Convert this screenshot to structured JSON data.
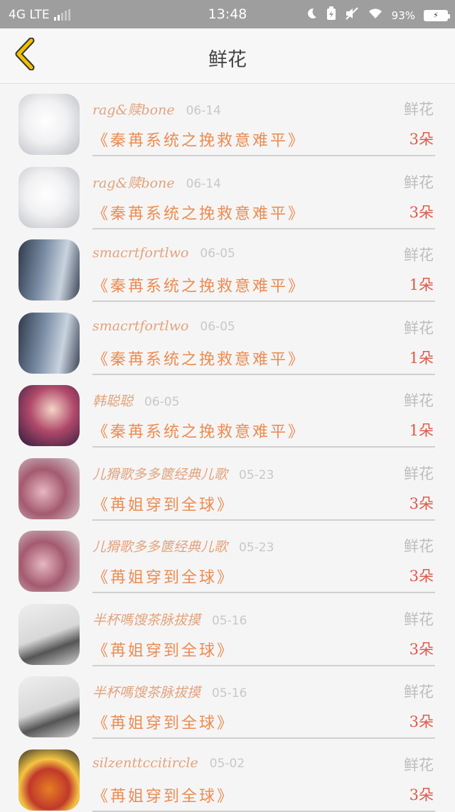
{
  "status_bar": {
    "network": "4G LTE",
    "time": "13:48",
    "battery_percent": "93%",
    "icons": [
      "moon-icon",
      "battery-saver-icon",
      "mute-icon",
      "wifi-icon"
    ]
  },
  "header": {
    "back_icon": "chevron-left-icon",
    "title": "鲜花",
    "accent_color": "#f0c000"
  },
  "gifts": [
    {
      "avatar": "cat",
      "user": "rag&赎bone",
      "date": "06-14",
      "type": "鲜花",
      "book": "《秦苒系统之挽救意难平》",
      "count": "3朵"
    },
    {
      "avatar": "cat",
      "user": "rag&赎bone",
      "date": "06-14",
      "type": "鲜花",
      "book": "《秦苒系统之挽救意难平》",
      "count": "3朵"
    },
    {
      "avatar": "girl",
      "user": "smacrtfortlwo",
      "date": "06-05",
      "type": "鲜花",
      "book": "《秦苒系统之挽救意难平》",
      "count": "1朵"
    },
    {
      "avatar": "girl",
      "user": "smacrtfortlwo",
      "date": "06-05",
      "type": "鲜花",
      "book": "《秦苒系统之挽救意难平》",
      "count": "1朵"
    },
    {
      "avatar": "anime",
      "user": "韩聪聪",
      "date": "06-05",
      "type": "鲜花",
      "book": "《秦苒系统之挽救意难平》",
      "count": "1朵"
    },
    {
      "avatar": "flower",
      "user": "儿猾歌多多篋经典儿歌",
      "date": "05-23",
      "type": "鲜花",
      "book": "《苒姐穿到全球》",
      "count": "3朵"
    },
    {
      "avatar": "flower",
      "user": "儿猾歌多多篋经典儿歌",
      "date": "05-23",
      "type": "鲜花",
      "book": "《苒姐穿到全球》",
      "count": "3朵"
    },
    {
      "avatar": "guy",
      "user": "半杯嗎馊茶脉拔摸",
      "date": "05-16",
      "type": "鲜花",
      "book": "《苒姐穿到全球》",
      "count": "3朵"
    },
    {
      "avatar": "guy",
      "user": "半杯嗎馊茶脉拔摸",
      "date": "05-16",
      "type": "鲜花",
      "book": "《苒姐穿到全球》",
      "count": "3朵"
    },
    {
      "avatar": "lion",
      "user": "silzenttccitircle",
      "date": "05-02",
      "type": "鲜花",
      "book": "《苒姐穿到全球》",
      "count": "3朵"
    }
  ]
}
